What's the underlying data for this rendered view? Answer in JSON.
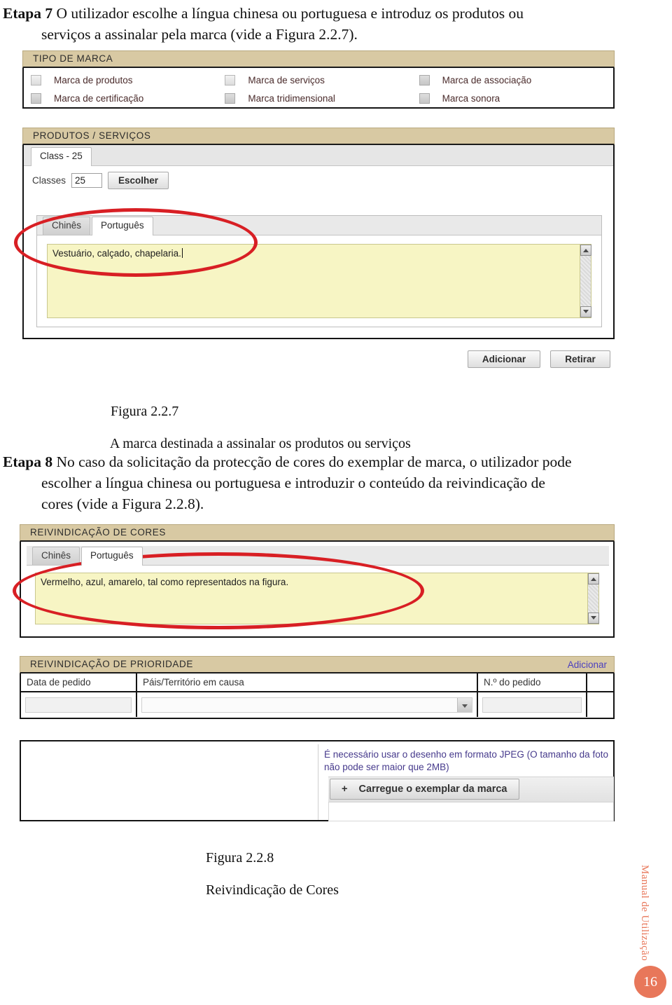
{
  "document": {
    "steps": [
      {
        "label": "Etapa 7",
        "text": "O utilizador escolhe a língua chinesa ou portuguesa e introduz os produtos ou",
        "text_line2": "serviços a assinalar pela marca (vide a Figura 2.2.7)."
      },
      {
        "label": "Etapa 8",
        "text": "No caso da solicitação da protecção de cores do exemplar de marca, o utilizador pode",
        "text_line2": "escolher a língua chinesa ou portuguesa e introduzir o conteúdo da reivindicação de",
        "text_line3": "cores (vide a Figura 2.2.8)."
      }
    ],
    "captions": [
      {
        "number": "Figura 2.2.7",
        "title": "A marca destinada a assinalar os produtos ou serviços"
      },
      {
        "number": "Figura 2.2.8",
        "title": "Reivindicação de Cores"
      }
    ],
    "footer": {
      "running_title": "Manual de Utilização",
      "page_number": "16"
    },
    "colors": {
      "panel_bar": "#d8c9a3",
      "annotation": "#d81f24",
      "textarea": "#f7f5c4",
      "link": "#4b3fbf",
      "footer_accent": "#e8775a"
    }
  },
  "figure_227": {
    "tipo_de_marca": {
      "panel_title": "TIPO DE MARCA",
      "checkboxes": [
        {
          "label": "Marca de produtos",
          "checked": false
        },
        {
          "label": "Marca de serviços",
          "checked": false
        },
        {
          "label": "Marca de associação",
          "checked": false
        },
        {
          "label": "Marca de certificação",
          "checked": false
        },
        {
          "label": "Marca tridimensional",
          "checked": false
        },
        {
          "label": "Marca sonora",
          "checked": false
        }
      ]
    },
    "produtos_servicos": {
      "panel_title": "PRODUTOS / SERVIÇOS",
      "class_tab": "Class - 25",
      "classes_label": "Classes",
      "classes_value": "25",
      "escolher_button": "Escolher",
      "language_tabs": [
        {
          "label": "Chinês",
          "active": false
        },
        {
          "label": "Português",
          "active": true
        }
      ],
      "textarea_value": "Vestuário, calçado, chapelaria.",
      "buttons": [
        {
          "label": "Adicionar"
        },
        {
          "label": "Retirar"
        }
      ]
    }
  },
  "figure_228": {
    "reivindicacao_cores": {
      "panel_title": "REIVINDICAÇÃO DE CORES",
      "language_tabs": [
        {
          "label": "Chinês",
          "active": false
        },
        {
          "label": "Português",
          "active": true
        }
      ],
      "textarea_value": "Vermelho, azul, amarelo, tal como representados na figura."
    },
    "reivindicacao_prioridade": {
      "panel_title": "REIVINDICAÇÃO DE PRIORIDADE",
      "add_link": "Adicionar",
      "columns": [
        {
          "header": "Data de pedido"
        },
        {
          "header": "Páis/Território em causa"
        },
        {
          "header": "N.º do pedido"
        },
        {
          "header": ""
        }
      ],
      "row": [
        {
          "value": ""
        },
        {
          "value": ""
        },
        {
          "value": ""
        },
        {
          "value": ""
        }
      ]
    },
    "upload": {
      "note_line1": "É necessário usar o desenho em formato JPEG (O tamanho da foto",
      "note_line2": "não pode ser maior que 2MB)",
      "button_label": "Carregue o exemplar da marca",
      "button_plus": "+"
    }
  }
}
